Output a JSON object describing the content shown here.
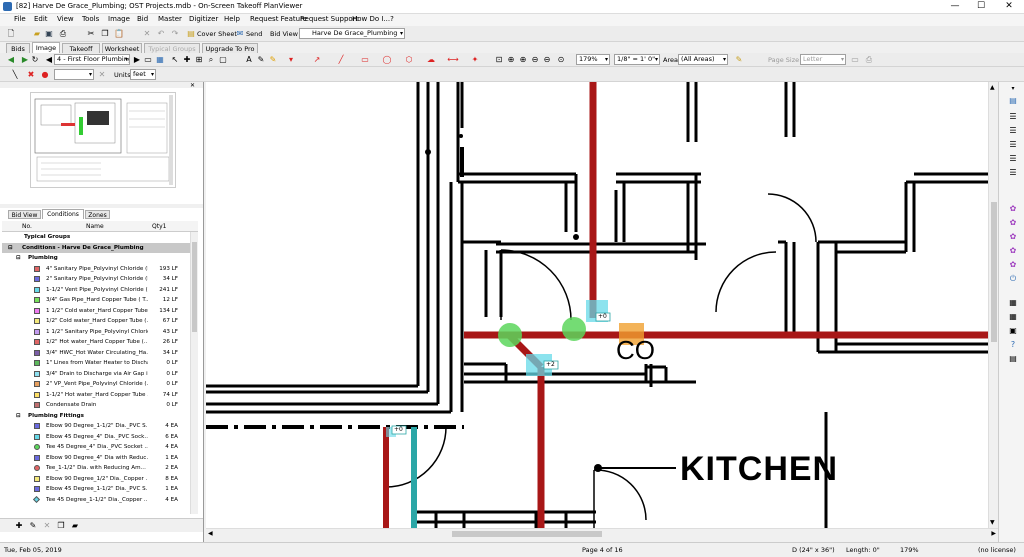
{
  "window": {
    "title": "[82] Harve De Grace_Plumbing; OST Projects.mdb - On-Screen Takeoff PlanViewer",
    "minimize": "—",
    "maximize": "☐",
    "close": "✕"
  },
  "menu": [
    "File",
    "Edit",
    "View",
    "Tools",
    "Image",
    "Bid",
    "Master",
    "Digitizer",
    "Help",
    "Request Feature",
    "Request Support",
    "How Do I...?"
  ],
  "toolbar1": {
    "cover_sheet": "Cover Sheet",
    "send": "Send",
    "bid_view_label": "Bid View",
    "bid_view_value": "Harve De Grace_Plumbing"
  },
  "tabs": [
    "Bids",
    "Image",
    "Takeoff",
    "Worksheet",
    "Typical Groups",
    "Upgrade To Pro"
  ],
  "active_tab": "Image",
  "toolbar2": {
    "page_select": "4 - First Floor Plumbing",
    "zoom": "179%",
    "scale": "1/8\" = 1' 0\"",
    "area_label": "Area",
    "area_value": "(All Areas)",
    "page_size_label": "Page Size",
    "page_size_value": "Letter"
  },
  "toolbar3": {
    "units_label": "Units",
    "units_value": "feet"
  },
  "panel_tabs": [
    "Bid View",
    "Conditions",
    "Zones"
  ],
  "active_panel_tab": "Conditions",
  "columns": {
    "no": "No.",
    "name": "Name",
    "qty": "Qty1"
  },
  "groups": {
    "typical": "Typical Groups",
    "conditions_header": "Conditions - Harve De Grace_Plumbing",
    "plumbing": "Plumbing",
    "fittings": "Plumbing Fittings"
  },
  "plumbing_items": [
    {
      "name": "4\" Sanitary Pipe_Polyvinyl Chloride (P...",
      "qty": "193 LF",
      "color": "#e06666"
    },
    {
      "name": "2\" Sanitary Pipe_Polyvinyl Chloride (P...",
      "qty": "34 LF",
      "color": "#6a6adf"
    },
    {
      "name": "1-1/2\" Vent Pipe_Polyvinyl Chloride (...",
      "qty": "241 LF",
      "color": "#66d9e8"
    },
    {
      "name": "3/4\" Gas Pipe_Hard Copper Tube ( T...",
      "qty": "12 LF",
      "color": "#76e05a"
    },
    {
      "name": "1 1/2\" Cold water_Hard Copper Tube ...",
      "qty": "134 LF",
      "color": "#ef7af0"
    },
    {
      "name": "1/2\" Cold water_Hard Copper Tube (...",
      "qty": "67 LF",
      "color": "#f4e97a"
    },
    {
      "name": "1 1/2\" Sanitary Pipe_Polyvinyl Chlorid...",
      "qty": "43 LF",
      "color": "#c39bf0"
    },
    {
      "name": "1/2\" Hot water_Hard Copper Tube (...",
      "qty": "26 LF",
      "color": "#e06666"
    },
    {
      "name": "3/4\" HWC_Hot Water Circulating_Ha...",
      "qty": "34 LF",
      "color": "#7b5ea7"
    },
    {
      "name": "1\" Lines from Water Heater to Discha...",
      "qty": "0 LF",
      "color": "#5cb85c"
    },
    {
      "name": "3/4\" Drain to Discharge via Air Gap i...",
      "qty": "0 LF",
      "color": "#8ee0f0"
    },
    {
      "name": "2\" VP_Vent Pipe_Polyvinyl Chloride (...",
      "qty": "0 LF",
      "color": "#e8a060"
    },
    {
      "name": "1-1/2\" Hot water_Hard Copper Tube ...",
      "qty": "74 LF",
      "color": "#ffe066"
    },
    {
      "name": "Condensate Drain",
      "qty": "0 LF",
      "color": "#c07070"
    }
  ],
  "fitting_items": [
    {
      "name": "Elbow 90 Degree_1-1/2\" Dia._PVC S...",
      "qty": "4 EA",
      "color": "#6a6adf",
      "shape": "square"
    },
    {
      "name": "Elbow 45 Degree_4\" Dia._PVC Sock...",
      "qty": "6 EA",
      "color": "#66d9e8",
      "shape": "square"
    },
    {
      "name": "Tee 45 Degree_4\" Dia._PVC Socket ...",
      "qty": "4 EA",
      "color": "#5cd65c",
      "shape": "circle"
    },
    {
      "name": "Elbow 90 Degree_4\" Dia with Reduc...",
      "qty": "1 EA",
      "color": "#6a6adf",
      "shape": "square"
    },
    {
      "name": "Tee_1-1/2\" Dia. with Reducing Am...",
      "qty": "2 EA",
      "color": "#e06666",
      "shape": "circle"
    },
    {
      "name": "Elbow 90 Degree_1/2\" Dia._Copper ...",
      "qty": "8 EA",
      "color": "#f4e97a",
      "shape": "square"
    },
    {
      "name": "Elbow 45 Degree_1-1/2\" Dia._PVC S...",
      "qty": "1 EA",
      "color": "#6a6adf",
      "shape": "square"
    },
    {
      "name": "Tee 45 Degree_1-1/2\" Dia._Copper ...",
      "qty": "4 EA",
      "color": "#66d9e8",
      "shape": "diamond"
    }
  ],
  "drawing": {
    "room_label": "KITCHEN",
    "co_label": "CO",
    "tag_a": "+0",
    "tag_b": "+2",
    "tag_c": "+0"
  },
  "status": {
    "date": "Tue, Feb 05, 2019",
    "page": "Page 4 of 16",
    "paper": "D (24\" x 36\")",
    "length": "Length: 0\"",
    "zoom": "179%",
    "license": "(no license)"
  },
  "colors": {
    "red_pipe": "#a81717",
    "cyan_pipe": "#2aa6a6",
    "green_fitting": "#5cd65c",
    "orange_fitting": "#f0a030"
  }
}
